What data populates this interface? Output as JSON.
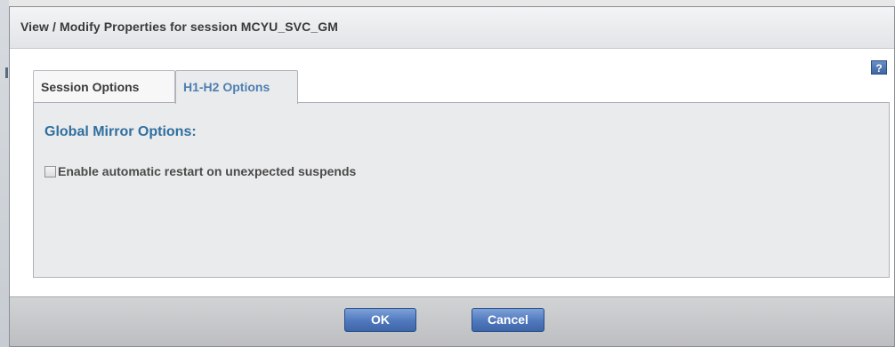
{
  "dialog": {
    "title": "View / Modify Properties for session MCYU_SVC_GM",
    "help_label": "?"
  },
  "tabs": [
    {
      "label": "Session Options",
      "active": false
    },
    {
      "label": "H1-H2 Options",
      "active": true
    }
  ],
  "panel": {
    "section_title": "Global Mirror Options:",
    "checkbox": {
      "label": "Enable automatic restart on unexpected suspends",
      "checked": false
    }
  },
  "footer": {
    "ok_label": "OK",
    "cancel_label": "Cancel"
  },
  "colors": {
    "accent_blue": "#4d7fb2",
    "section_title": "#2f6f9f",
    "button_blue": "#4f78bd"
  }
}
